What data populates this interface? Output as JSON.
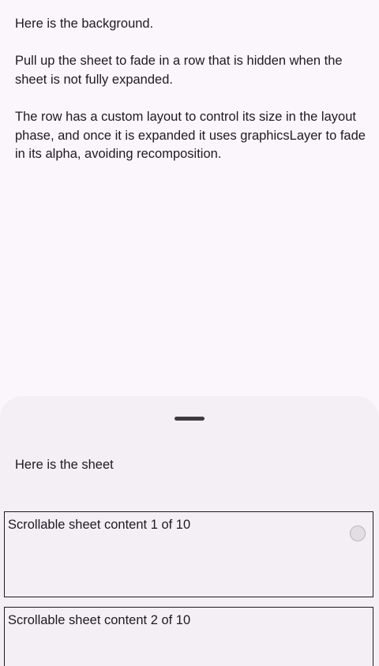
{
  "background": {
    "paragraphs": [
      "Here is the background.",
      "Pull up the sheet to fade in a row that is hidden when the sheet is not fully expanded.",
      "The row has a custom layout to control its size in the layout phase, and once it is expanded it uses graphicsLayer to fade in its alpha, avoiding recomposition."
    ]
  },
  "sheet": {
    "title": "Here is the sheet",
    "items": [
      {
        "label": "Scrollable sheet content 1 of 10"
      },
      {
        "label": "Scrollable sheet content 2 of 10"
      }
    ]
  },
  "colors": {
    "background": "#fbf6fb",
    "sheet": "#f4eff4",
    "text": "#1d1b20"
  }
}
